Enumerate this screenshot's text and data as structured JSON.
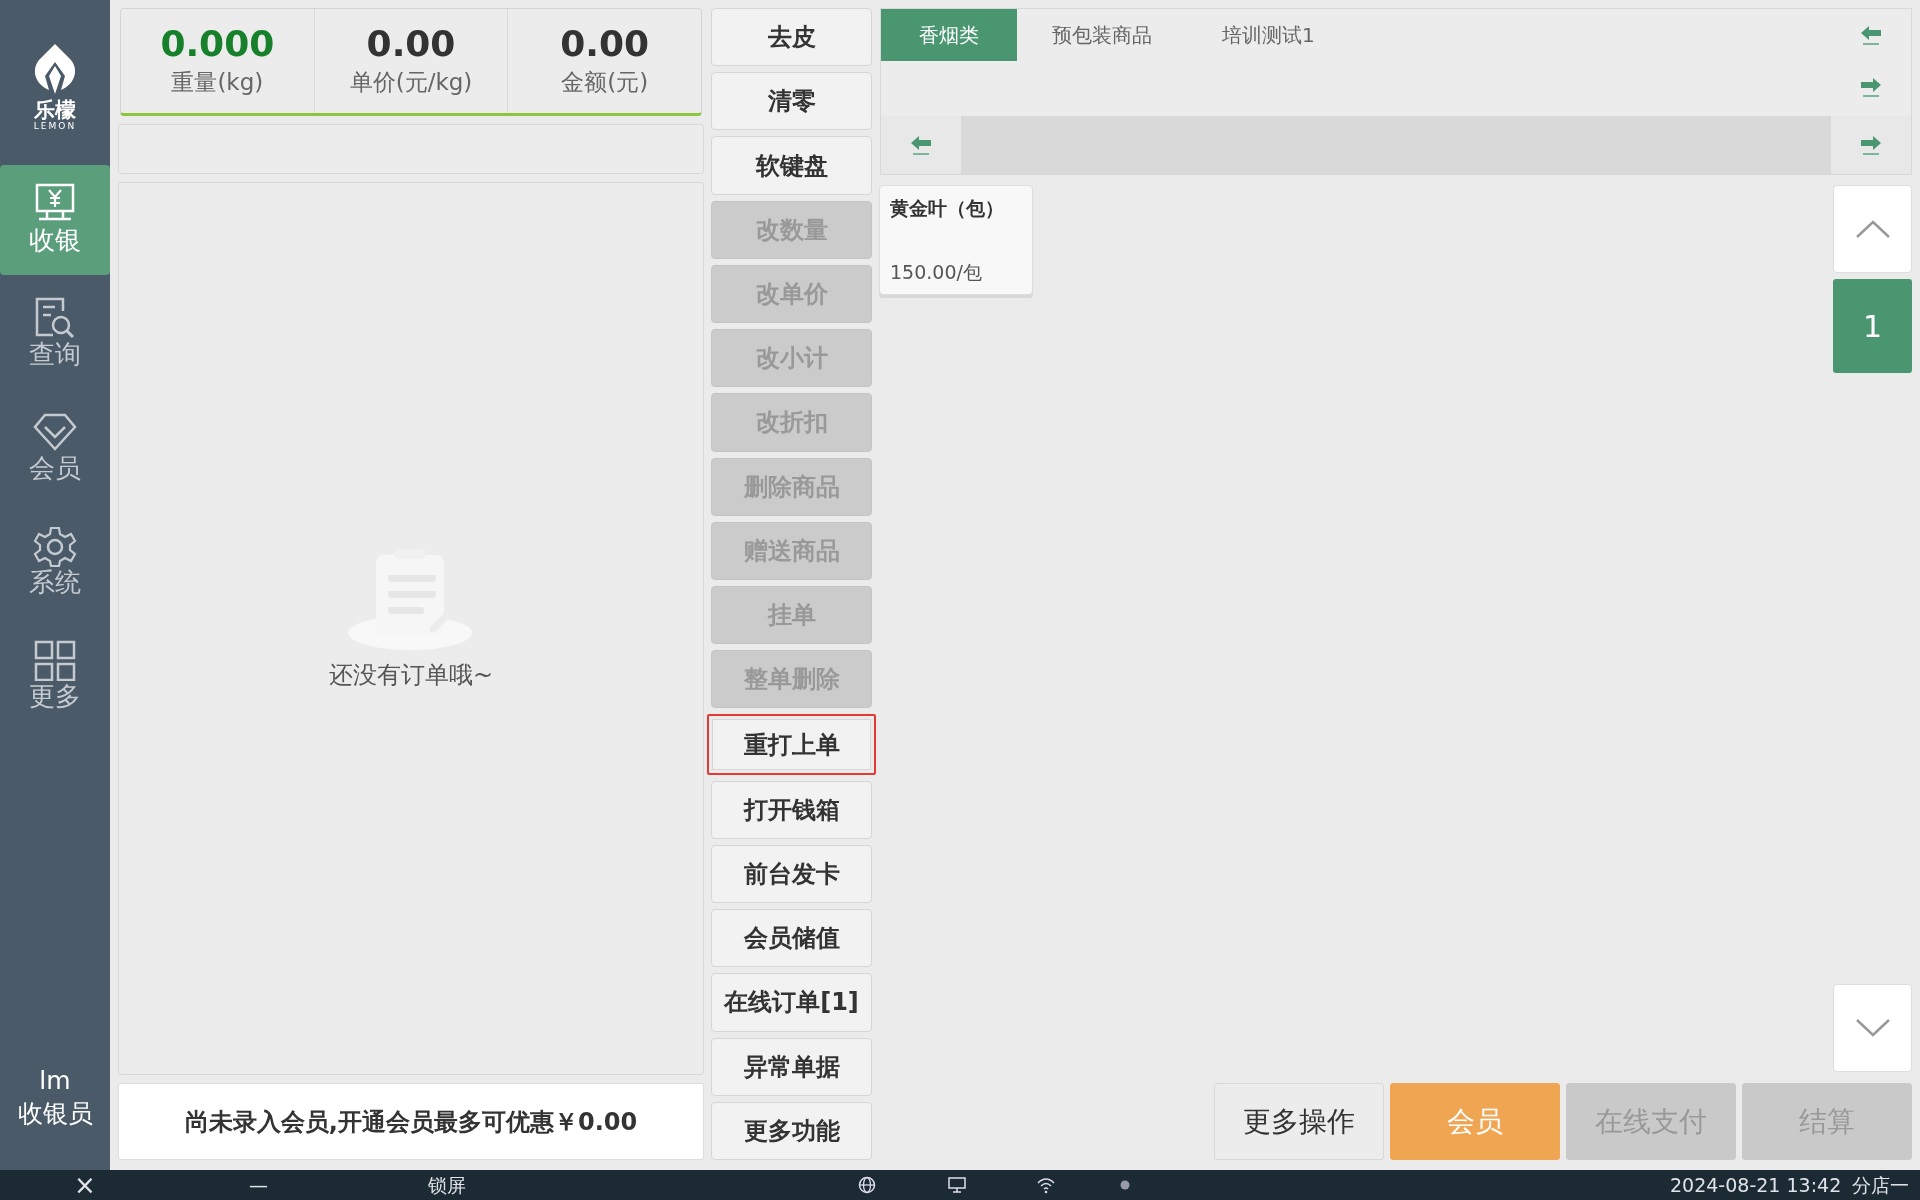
{
  "sidebar": {
    "logo_text": "乐檬",
    "logo_subtext": "LEMON",
    "items": [
      {
        "label": "收银",
        "selected": true
      },
      {
        "label": "查询",
        "selected": false
      },
      {
        "label": "会员",
        "selected": false
      },
      {
        "label": "系统",
        "selected": false
      },
      {
        "label": "更多",
        "selected": false
      }
    ],
    "user": {
      "name": "lm",
      "role": "收银员"
    }
  },
  "scale_display": [
    {
      "value": "0.000",
      "label": "重量(kg)",
      "highlight": true
    },
    {
      "value": "0.00",
      "label": "单价(元/kg)",
      "highlight": false
    },
    {
      "value": "0.00",
      "label": "金额(元)",
      "highlight": false
    }
  ],
  "order_list": {
    "empty_message": "还没有订单哦~"
  },
  "member_banner": "尚未录入会员,开通会员最多可优惠￥0.00",
  "function_buttons": [
    {
      "label": "去皮",
      "disabled": false,
      "highlighted": false
    },
    {
      "label": "清零",
      "disabled": false,
      "highlighted": false
    },
    {
      "label": "软键盘",
      "disabled": false,
      "highlighted": false
    },
    {
      "label": "改数量",
      "disabled": true,
      "highlighted": false
    },
    {
      "label": "改单价",
      "disabled": true,
      "highlighted": false
    },
    {
      "label": "改小计",
      "disabled": true,
      "highlighted": false
    },
    {
      "label": "改折扣",
      "disabled": true,
      "highlighted": false
    },
    {
      "label": "删除商品",
      "disabled": true,
      "highlighted": false
    },
    {
      "label": "赠送商品",
      "disabled": true,
      "highlighted": false
    },
    {
      "label": "挂单",
      "disabled": true,
      "highlighted": false
    },
    {
      "label": "整单删除",
      "disabled": true,
      "highlighted": false
    },
    {
      "label": "重打上单",
      "disabled": false,
      "highlighted": true
    },
    {
      "label": "打开钱箱",
      "disabled": false,
      "highlighted": false
    },
    {
      "label": "前台发卡",
      "disabled": false,
      "highlighted": false
    },
    {
      "label": "会员储值",
      "disabled": false,
      "highlighted": false
    },
    {
      "label": "在线订单[1]",
      "disabled": false,
      "highlighted": false
    },
    {
      "label": "异常单据",
      "disabled": false,
      "highlighted": false
    },
    {
      "label": "更多功能",
      "disabled": false,
      "highlighted": false
    }
  ],
  "categories": [
    {
      "label": "香烟类",
      "selected": true
    },
    {
      "label": "预包装商品",
      "selected": false
    },
    {
      "label": "培训测试1",
      "selected": false
    }
  ],
  "products": [
    {
      "name": "黄金叶（包）",
      "price": "150.00/包"
    }
  ],
  "pager": {
    "pages": [
      {
        "label": "1",
        "selected": true
      }
    ]
  },
  "actions": [
    {
      "label": "更多操作",
      "kind": "plain",
      "disabled": false
    },
    {
      "label": "会员",
      "kind": "accent",
      "disabled": false
    },
    {
      "label": "在线支付",
      "kind": "plain",
      "disabled": true
    },
    {
      "label": "结算",
      "kind": "plain",
      "disabled": true
    }
  ],
  "taskbar": {
    "close": "×",
    "minimize": "—",
    "lock": "锁屏",
    "datetime": "2024-08-21 13:42",
    "store": "分店一"
  }
}
